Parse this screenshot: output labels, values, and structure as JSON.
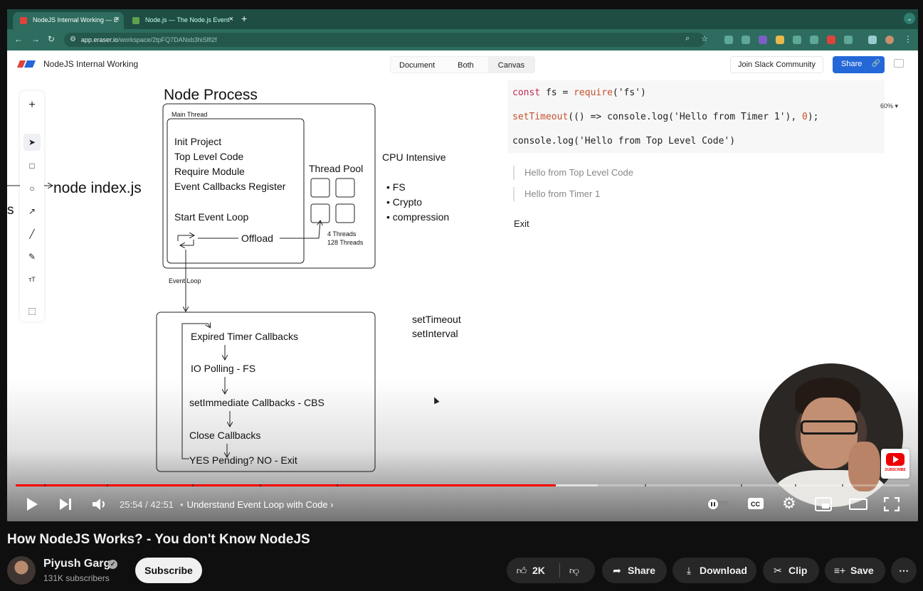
{
  "browser": {
    "tabs": [
      {
        "title": "NodeJS Internal Working — E",
        "active": true
      },
      {
        "title": "Node.js — The Node.js Event",
        "active": false
      }
    ],
    "url_host": "app.eraser.io",
    "url_path": "/workspace/2tpFQ7DANxb3hiSlfl2f"
  },
  "eraser": {
    "doc_title": "NodeJS Internal Working",
    "view_modes": [
      "Document",
      "Both",
      "Canvas"
    ],
    "active_view": "Canvas",
    "slack_label": "Join Slack Community",
    "share_label": "Share",
    "zoom": "60%",
    "diagram": {
      "node_process_title": "Node Process",
      "main_thread_label": "Main Thread",
      "main_thread_steps": [
        "Init Project",
        "Top Level Code",
        "Require Module",
        "Event Callbacks Register"
      ],
      "start_event_loop": "Start Event Loop",
      "offload": "Offload",
      "thread_pool_title": "Thread Pool",
      "threads_default": "4 Threads",
      "threads_max": "128 Threads",
      "cpu_intensive_title": "CPU Intensive",
      "cpu_items": [
        "• FS",
        "• Crypto",
        "• compression"
      ],
      "entry_command": "node index.js",
      "cut_off_letter": "s",
      "event_loop_label": "Event Loop",
      "event_loop_phases": [
        "Expired Timer Callbacks",
        "IO Polling - FS",
        "setImmediate Callbacks - CBS",
        "Close Callbacks",
        "YES Pending? NO - Exit"
      ],
      "timer_note_1": "setTimeout",
      "timer_note_2": "setInterval"
    },
    "code": {
      "line1": {
        "kw": "const",
        "mid": " fs = ",
        "fn": "require",
        "tail": "('fs')"
      },
      "line2": {
        "fn": "setTimeout",
        "mid": "(() => console.log('Hello from Timer 1'), ",
        "num": "0",
        "tail": ");"
      },
      "line3": "console.log('Hello from Top Level Code')"
    },
    "output": [
      "Hello from Top Level Code",
      "Hello from Timer 1"
    ],
    "exit_text": "Exit"
  },
  "player": {
    "current_time": "25:54",
    "duration": "42:51",
    "time_display": "25:54 / 42:51",
    "chapter_title": "Understand Event Loop with Code",
    "progress_fraction": 0.6045,
    "buffered_fraction": 0.6515,
    "subscribe_watermark": "SUBSCRIBE"
  },
  "video": {
    "title": "How NodeJS Works? - You don't Know NodeJS",
    "channel": "Piyush Garg",
    "subscribers": "131K subscribers",
    "subscribe_label": "Subscribe",
    "likes": "2K",
    "share_label": "Share",
    "download_label": "Download",
    "clip_label": "Clip",
    "save_label": "Save"
  },
  "colors": {
    "accent_red": "#ff0000",
    "chrome_green": "#2d6c5f",
    "eraser_blue": "#2468d8"
  }
}
